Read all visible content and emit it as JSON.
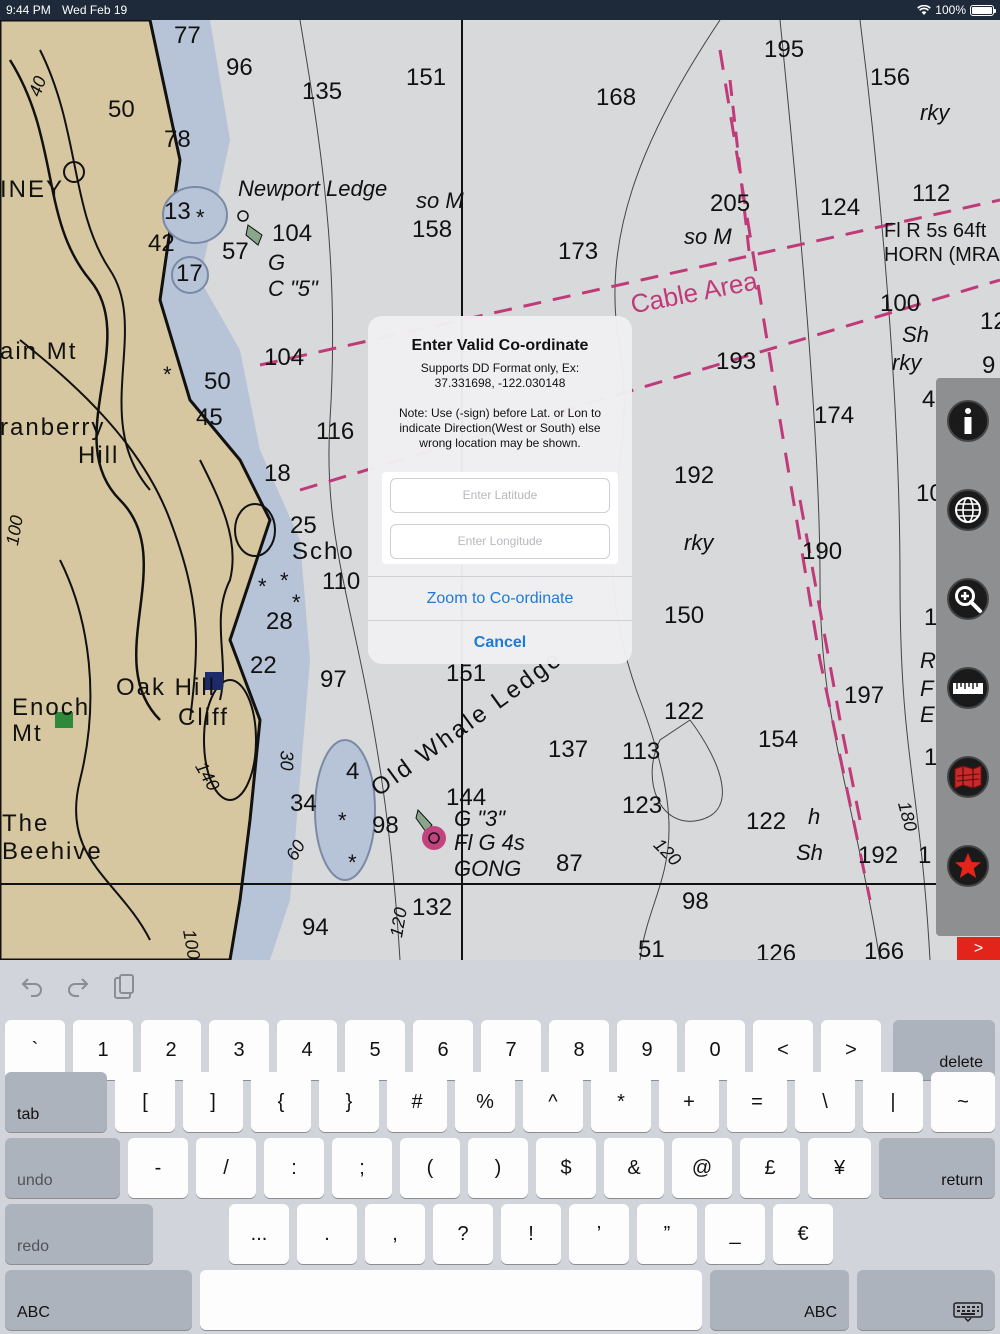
{
  "status_bar": {
    "time": "9:44 PM",
    "date": "Wed Feb 19",
    "battery": "100%",
    "battery_level": 1.0
  },
  "map": {
    "labels": {
      "s77": "77",
      "s96": "96",
      "s135": "135",
      "s151a": "151",
      "s168": "168",
      "s195": "195",
      "s156": "156",
      "s50a": "50",
      "s78": "78",
      "s40": "40",
      "s158": "158",
      "s173": "173",
      "s205": "205",
      "s124": "124",
      "s112": "112",
      "s13": "13",
      "s42": "42",
      "s57": "57",
      "s17": "17",
      "s104a": "104",
      "s104b": "104",
      "s50b": "50",
      "s45": "45",
      "s116": "116",
      "s18": "18",
      "s25": "25",
      "s110": "110",
      "s28": "28",
      "s22": "22",
      "s97": "97",
      "s151b": "151",
      "s193": "193",
      "s174": "174",
      "s100": "100",
      "s192a": "192",
      "s190": "190",
      "s150": "150",
      "s122a": "122",
      "s137": "137",
      "s113": "113",
      "s154": "154",
      "s197": "197",
      "s4": "4",
      "s34": "34",
      "s98a": "98",
      "s144": "144",
      "s123": "123",
      "s122b": "122",
      "s87": "87",
      "s192b": "192",
      "s132": "132",
      "s94": "94",
      "s98b": "98",
      "s51": "51",
      "s126": "126",
      "s166": "166",
      "newport": "Newport Ledge",
      "soM1": "so M",
      "soM2": "so M",
      "rky1": "rky",
      "rky2": "rky",
      "rky3": "rky",
      "sh1": "Sh",
      "sh2": "Sh",
      "h": "h",
      "g": "G",
      "c5": "C \"5\"",
      "g3": "G \"3\"",
      "flg": "Fl G 4s",
      "gong": "GONG",
      "flr": "Fl R 5s 64ft",
      "horn": "HORN (MRA",
      "cable": "Cable Area",
      "whale": "Old Whale Ledge",
      "iney": "INEY",
      "ainmt": "ain Mt",
      "cranberry": "ranberry",
      "hill": "Hill",
      "scho": "Scho",
      "oakhill": "Oak Hill",
      "cliff": "Cliff",
      "enoch": "Enoch",
      "mt": "Mt",
      "the": "The",
      "beehive": "Beehive",
      "d180": "180",
      "d120a": "120",
      "d120b": "120",
      "d140": "140",
      "d30": "30",
      "d60": "60",
      "d100a": "100",
      "d100b": "100",
      "edge1": "12",
      "edge2": "9",
      "edge3": "4",
      "edge4": "10",
      "edge5": "1",
      "edge6": "R",
      "edge7": "F",
      "edge8": "E",
      "edge9": "1",
      "edge10": "1"
    }
  },
  "toolbar": {
    "buttons": [
      {
        "name": "info-icon"
      },
      {
        "name": "globe-icon"
      },
      {
        "name": "zoom-in-icon"
      },
      {
        "name": "ruler-icon"
      },
      {
        "name": "map-icon"
      },
      {
        "name": "star-icon"
      }
    ],
    "tab_glyph": ">"
  },
  "dialog": {
    "title": "Enter Valid Co-ordinate",
    "message": "Supports DD Format only, Ex:\n37.331698, -122.030148\n\nNote: Use (-sign) before Lat. or Lon to indicate Direction(West or South) else wrong location may be shown.",
    "latitude_placeholder": "Enter Latitude",
    "longitude_placeholder": "Enter Longitude",
    "zoom_label": "Zoom to Co-ordinate",
    "cancel_label": "Cancel"
  },
  "keyboard": {
    "row1": [
      "`",
      "1",
      "2",
      "3",
      "4",
      "5",
      "6",
      "7",
      "8",
      "9",
      "0",
      "<",
      ">"
    ],
    "row2": [
      "[",
      "]",
      "{",
      "}",
      "#",
      "%",
      "^",
      "*",
      "+",
      "=",
      "\\",
      "|",
      "~"
    ],
    "row3": [
      "-",
      "/",
      ":",
      ";",
      "(",
      ")",
      "$",
      "&",
      "@",
      "£",
      "¥"
    ],
    "row4": [
      "...",
      ".",
      ",",
      "?",
      "!",
      "’",
      "”",
      "_",
      "€"
    ],
    "delete": "delete",
    "tab": "tab",
    "undo": "undo",
    "return": "return",
    "redo": "redo",
    "abc_left": "ABC",
    "abc_right": "ABC"
  }
}
